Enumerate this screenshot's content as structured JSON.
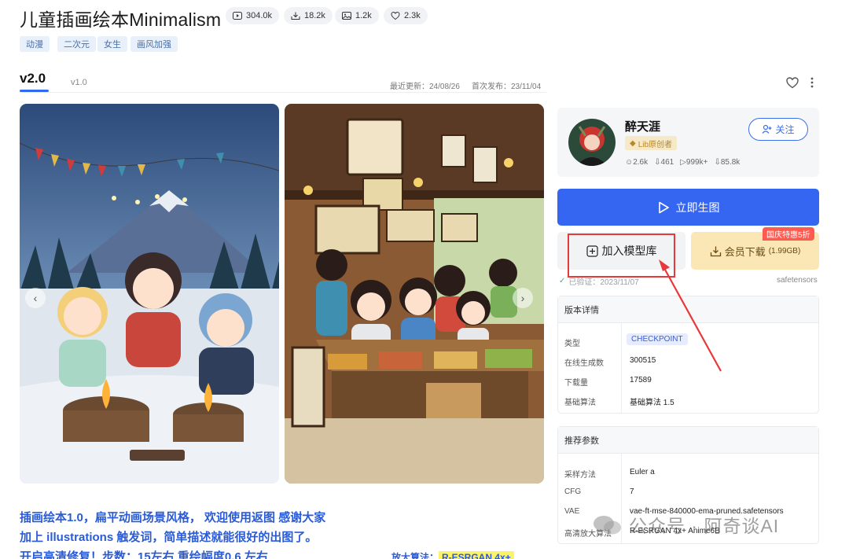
{
  "title": "儿童插画绘本Minimalism",
  "stats": {
    "runs": "304.0k",
    "downloads": "18.2k",
    "images": "1.2k",
    "likes": "2.3k"
  },
  "tags": [
    "动漫",
    "二次元",
    "女生",
    "画风加强"
  ],
  "versions": {
    "active": "v2.0",
    "other": "v1.0"
  },
  "meta": {
    "updated": "最近更新：24/08/26",
    "published": "首次发布：23/11/04"
  },
  "author": {
    "name": "醉天涯",
    "badge": "Lib原创者",
    "follow": "关注",
    "stat_followers": "2.6k",
    "stat_likes": "461",
    "stat_runs": "999k+",
    "stat_downloads": "85.8k"
  },
  "actions": {
    "generate": "立即生图",
    "add_library": "加入模型库",
    "download": "会员下载",
    "download_size": "(1.99GB)",
    "promo": "国庆特惠5折"
  },
  "verified": "已验证：2023/11/07",
  "file_format": "safetensors",
  "version_details": {
    "header": "版本详情",
    "rows": [
      {
        "key": "类型",
        "value": "CHECKPOINT"
      },
      {
        "key": "在线生成数",
        "value": "300515"
      },
      {
        "key": "下载量",
        "value": "17589"
      },
      {
        "key": "基础算法",
        "value": "基础算法 1.5"
      }
    ]
  },
  "recommended": {
    "header": "推荐参数",
    "rows": [
      {
        "key": "采样方法",
        "value": "Euler a"
      },
      {
        "key": "CFG",
        "value": "7"
      },
      {
        "key": "VAE",
        "value": "vae-ft-mse-840000-ema-pruned.safetensors"
      },
      {
        "key": "高清放大算法",
        "value": "R-ESRGAN 4x+ Anime6B"
      }
    ]
  },
  "description": {
    "line1": "插画绘本1.0，扁平动画场景风格， 欢迎使用返图 感谢大家",
    "line2": "加上 illustrations 触发词，简单描述就能很好的出图了。",
    "line3": "开启高清修复！步数：15左右     重绘幅度0.6    左右",
    "upscale_label": "放大算法：",
    "upscale_value": "R-ESRGAN 4x+"
  },
  "watermark": "公众号 · 阿奇谈AI",
  "colors": {
    "primary": "#3566f2",
    "accent_red": "#e8393a",
    "promo": "#ff5a4f"
  }
}
